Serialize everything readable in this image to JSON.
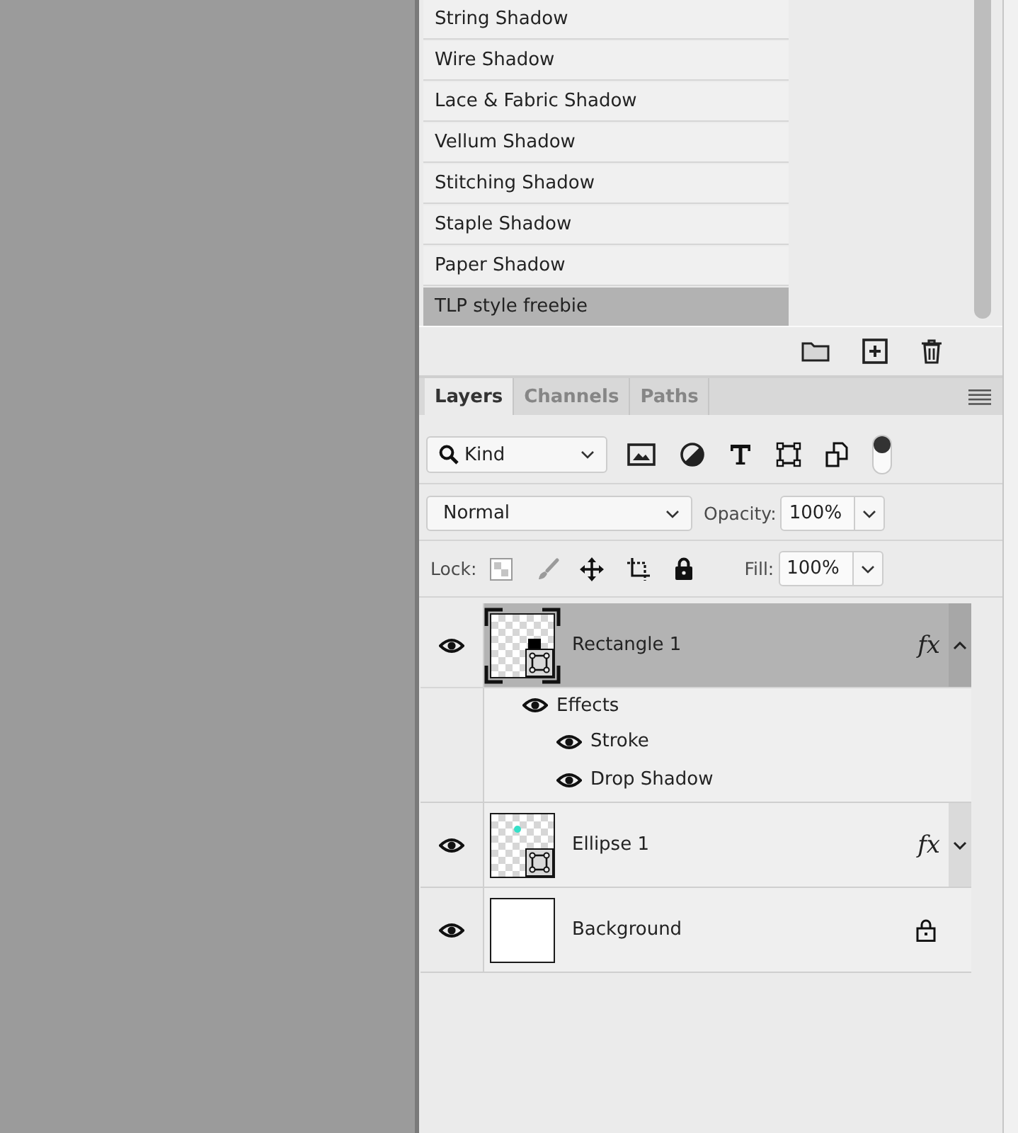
{
  "styles": [
    {
      "label": "String Shadow",
      "selected": false
    },
    {
      "label": "Wire Shadow",
      "selected": false
    },
    {
      "label": "Lace & Fabric Shadow",
      "selected": false
    },
    {
      "label": "Vellum Shadow",
      "selected": false
    },
    {
      "label": "Stitching Shadow",
      "selected": false
    },
    {
      "label": "Staple Shadow",
      "selected": false
    },
    {
      "label": "Paper Shadow",
      "selected": false
    },
    {
      "label": "TLP style freebie",
      "selected": true
    }
  ],
  "tabs": [
    {
      "label": "Layers",
      "selected": true
    },
    {
      "label": "Channels",
      "selected": false
    },
    {
      "label": "Paths",
      "selected": false
    }
  ],
  "filter": {
    "kind": "Kind",
    "on": true
  },
  "blend": {
    "mode": "Normal",
    "opacity_label": "Opacity:",
    "opacity": "100%"
  },
  "lock": {
    "label": "Lock:",
    "fill_label": "Fill:",
    "fill": "100%"
  },
  "layers": [
    {
      "name": "Rectangle 1",
      "kind": "rectangle",
      "color": "#000000",
      "selected": true,
      "visible": true,
      "locked": false,
      "fx": "fx",
      "expanded": true,
      "effects": [
        {
          "name": "Effects",
          "visible": true,
          "children": [
            {
              "name": "Stroke",
              "visible": true
            },
            {
              "name": "Drop Shadow",
              "visible": true
            }
          ]
        }
      ]
    },
    {
      "name": "Ellipse 1",
      "kind": "ellipse",
      "color": "#35e0c8",
      "selected": false,
      "visible": true,
      "locked": false,
      "fx": "fx",
      "expanded": false
    },
    {
      "name": "Background",
      "kind": "background",
      "selected": false,
      "visible": true,
      "locked": true
    }
  ]
}
